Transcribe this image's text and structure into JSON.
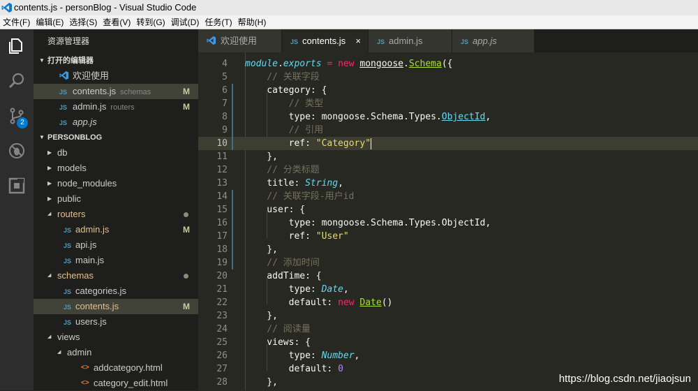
{
  "window": {
    "title": "contents.js - personBlog - Visual Studio Code"
  },
  "menu": [
    "文件(F)",
    "编辑(E)",
    "选择(S)",
    "查看(V)",
    "转到(G)",
    "调试(D)",
    "任务(T)",
    "帮助(H)"
  ],
  "activity": {
    "scm_badge": "2"
  },
  "sidebar": {
    "title": "资源管理器",
    "open_editors": {
      "header": "打开的编辑器",
      "items": [
        {
          "icon": "vscode-icon",
          "label": "欢迎使用",
          "desc": "",
          "mark": ""
        },
        {
          "icon": "JS",
          "label": "contents.js",
          "desc": "schemas",
          "mark": "M"
        },
        {
          "icon": "JS",
          "label": "admin.js",
          "desc": "routers",
          "mark": "M"
        },
        {
          "icon": "JS",
          "label": "app.js",
          "desc": "",
          "mark": ""
        }
      ]
    },
    "project": {
      "header": "PERSONBLOG",
      "items": [
        {
          "type": "folder",
          "label": "db",
          "open": false,
          "level": 0
        },
        {
          "type": "folder",
          "label": "models",
          "open": false,
          "level": 0
        },
        {
          "type": "folder",
          "label": "node_modules",
          "open": false,
          "level": 0
        },
        {
          "type": "folder",
          "label": "public",
          "open": false,
          "level": 0
        },
        {
          "type": "folder",
          "label": "routers",
          "open": true,
          "level": 0,
          "modified": true
        },
        {
          "type": "js",
          "label": "admin.js",
          "level": 1,
          "mark": "M"
        },
        {
          "type": "js",
          "label": "api.js",
          "level": 1
        },
        {
          "type": "js",
          "label": "main.js",
          "level": 1
        },
        {
          "type": "folder",
          "label": "schemas",
          "open": true,
          "level": 0,
          "modified": true
        },
        {
          "type": "js",
          "label": "categories.js",
          "level": 1
        },
        {
          "type": "js",
          "label": "contents.js",
          "level": 1,
          "mark": "M",
          "selected": true
        },
        {
          "type": "js",
          "label": "users.js",
          "level": 1
        },
        {
          "type": "folder",
          "label": "views",
          "open": true,
          "level": 0
        },
        {
          "type": "folder",
          "label": "admin",
          "open": true,
          "level": 1
        },
        {
          "type": "html",
          "label": "addcategory.html",
          "level": 2
        },
        {
          "type": "html",
          "label": "category_edit.html",
          "level": 2
        }
      ]
    }
  },
  "tabs": [
    {
      "icon": "vscode-icon",
      "label": "欢迎使用",
      "active": false
    },
    {
      "icon": "JS",
      "label": "contents.js",
      "active": true,
      "close": "×"
    },
    {
      "icon": "JS",
      "label": "admin.js",
      "active": false
    },
    {
      "icon": "JS",
      "label": "app.js",
      "active": false,
      "italic": true
    }
  ],
  "editor": {
    "current_line": 10,
    "lines": [
      {
        "n": "4",
        "t": [
          [
            "i",
            "module"
          ],
          [
            "",
            "."
          ],
          [
            "i",
            "exports"
          ],
          [
            "",
            " "
          ],
          [
            "k",
            "="
          ],
          [
            "",
            " "
          ],
          [
            "k",
            "new"
          ],
          [
            "",
            " "
          ],
          [
            "ul",
            "mongoose"
          ],
          [
            "",
            "."
          ],
          [
            "u",
            "Schema"
          ],
          [
            "",
            "({"
          ]
        ]
      },
      {
        "n": "5",
        "t": [
          [
            "c",
            "    // 关联字段"
          ]
        ]
      },
      {
        "n": "6",
        "t": [
          [
            "",
            "    category: {"
          ]
        ]
      },
      {
        "n": "7",
        "t": [
          [
            "c",
            "        // 类型"
          ]
        ]
      },
      {
        "n": "8",
        "t": [
          [
            "",
            "        type: mongoose.Schema.Types."
          ],
          [
            "link",
            "ObjectId"
          ],
          [
            "",
            ","
          ]
        ]
      },
      {
        "n": "9",
        "t": [
          [
            "c",
            "        // 引用"
          ]
        ]
      },
      {
        "n": "10",
        "t": [
          [
            "",
            "        ref: "
          ],
          [
            "s",
            "\"Category\""
          ]
        ]
      },
      {
        "n": "11",
        "t": [
          [
            "",
            "    },"
          ]
        ]
      },
      {
        "n": "12",
        "t": [
          [
            "c",
            "    // 分类标题"
          ]
        ]
      },
      {
        "n": "13",
        "t": [
          [
            "",
            "    title: "
          ],
          [
            "i",
            "String"
          ],
          [
            "",
            ","
          ]
        ]
      },
      {
        "n": "14",
        "t": [
          [
            "c",
            "    // 关联字段-用户id"
          ]
        ]
      },
      {
        "n": "15",
        "t": [
          [
            "",
            "    user: {"
          ]
        ]
      },
      {
        "n": "16",
        "t": [
          [
            "",
            "        type: mongoose.Schema.Types.ObjectId,"
          ]
        ]
      },
      {
        "n": "17",
        "t": [
          [
            "",
            "        ref: "
          ],
          [
            "s",
            "\"User\""
          ]
        ]
      },
      {
        "n": "18",
        "t": [
          [
            "",
            "    },"
          ]
        ]
      },
      {
        "n": "19",
        "t": [
          [
            "c",
            "    // 添加时间"
          ]
        ]
      },
      {
        "n": "20",
        "t": [
          [
            "",
            "    addTime: {"
          ]
        ]
      },
      {
        "n": "21",
        "t": [
          [
            "",
            "        type: "
          ],
          [
            "i",
            "Date"
          ],
          [
            "",
            ","
          ]
        ]
      },
      {
        "n": "22",
        "t": [
          [
            "",
            "        default: "
          ],
          [
            "k",
            "new"
          ],
          [
            "",
            " "
          ],
          [
            "u",
            "Date"
          ],
          [
            "",
            "()"
          ]
        ]
      },
      {
        "n": "23",
        "t": [
          [
            "",
            "    },"
          ]
        ]
      },
      {
        "n": "24",
        "t": [
          [
            "c",
            "    // 阅读量"
          ]
        ]
      },
      {
        "n": "25",
        "t": [
          [
            "",
            "    views: {"
          ]
        ]
      },
      {
        "n": "26",
        "t": [
          [
            "",
            "        type: "
          ],
          [
            "i",
            "Number"
          ],
          [
            "",
            ","
          ]
        ]
      },
      {
        "n": "27",
        "t": [
          [
            "",
            "        default: "
          ],
          [
            "n",
            "0"
          ]
        ]
      },
      {
        "n": "28",
        "t": [
          [
            "",
            "    },"
          ]
        ]
      }
    ]
  },
  "watermark": "https://blog.csdn.net/jiaojsun"
}
